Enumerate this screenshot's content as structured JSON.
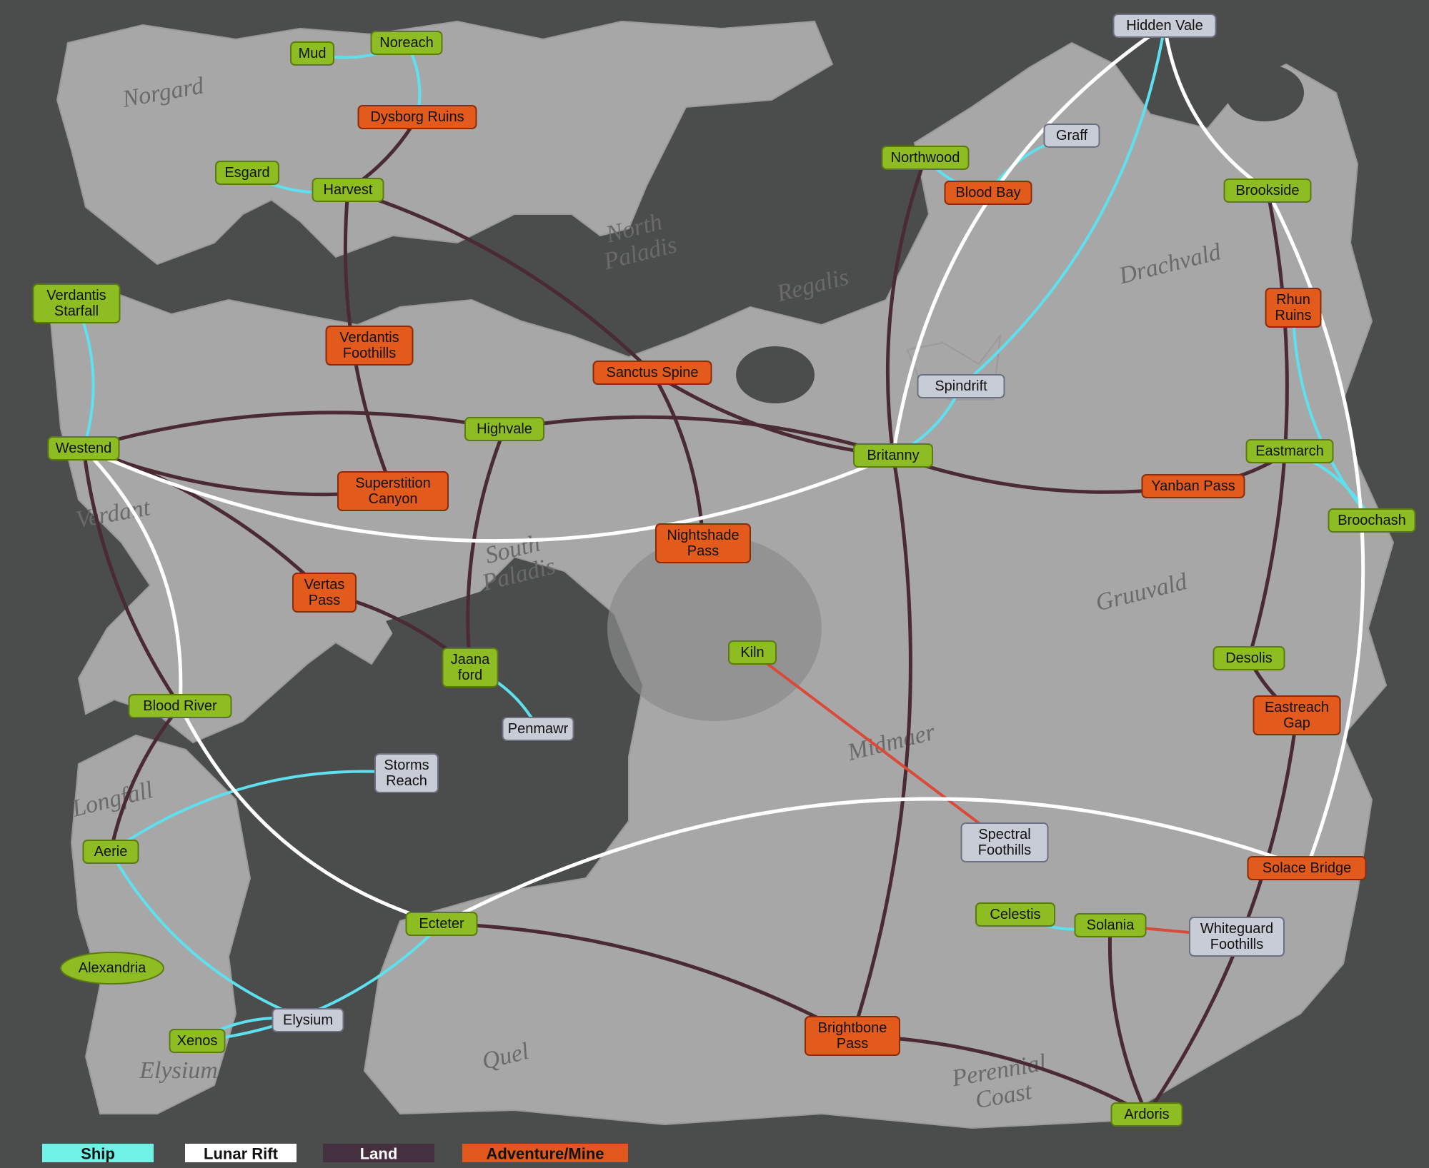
{
  "colors": {
    "background": "#4b4d4d",
    "land_mass": "#a7a7a7",
    "ship_route": "#5fe0ee",
    "lunar_rift": "#ffffff",
    "land_route": "#4a2a33",
    "adventure_route": "#d94a3a",
    "town_fill": "#8dbd22",
    "adventure_fill": "#e25a1c",
    "neutral_fill": "#c8ccd6"
  },
  "legend": [
    {
      "label": "Ship",
      "color": "#6ff3e6",
      "text_color": "#111111"
    },
    {
      "label": "Lunar Rift",
      "color": "#ffffff",
      "text_color": "#111111"
    },
    {
      "label": "Land",
      "color": "#45303f",
      "text_color": "#ffffff"
    },
    {
      "label": "Adventure/Mine",
      "color": "#e2581c",
      "text_color": "#111111"
    }
  ],
  "nodes": {
    "mud": {
      "label": "Mud",
      "type": "town"
    },
    "noreach": {
      "label": "Noreach",
      "type": "town"
    },
    "dysborg": {
      "label": "Dysborg Ruins",
      "type": "adventure"
    },
    "esgard": {
      "label": "Esgard",
      "type": "town"
    },
    "harvest": {
      "label": "Harvest",
      "type": "town"
    },
    "verdantis_starfall": {
      "label": "Verdantis\nStarfall",
      "type": "town"
    },
    "verdantis_foothills": {
      "label": "Verdantis\nFoothills",
      "type": "adventure"
    },
    "sanctus": {
      "label": "Sanctus Spine",
      "type": "adventure"
    },
    "westend": {
      "label": "Westend",
      "type": "town"
    },
    "highvale": {
      "label": "Highvale",
      "type": "town"
    },
    "superstition": {
      "label": "Superstition\nCanyon",
      "type": "adventure"
    },
    "britanny": {
      "label": "Britanny",
      "type": "town"
    },
    "nightshade": {
      "label": "Nightshade\nPass",
      "type": "adventure"
    },
    "vertas": {
      "label": "Vertas\nPass",
      "type": "adventure"
    },
    "jaanaford": {
      "label": "Jaana\nford",
      "type": "town"
    },
    "penmawr": {
      "label": "Penmawr",
      "type": "neutral"
    },
    "bloodriver": {
      "label": "Blood River",
      "type": "town"
    },
    "stormsreach": {
      "label": "Storms\nReach",
      "type": "neutral"
    },
    "kiln": {
      "label": "Kiln",
      "type": "town"
    },
    "aerie": {
      "label": "Aerie",
      "type": "town"
    },
    "alexandria": {
      "label": "Alexandria",
      "type": "town"
    },
    "ecteter": {
      "label": "Ecteter",
      "type": "town"
    },
    "elysium": {
      "label": "Elysium",
      "type": "neutral"
    },
    "xenos": {
      "label": "Xenos",
      "type": "town"
    },
    "brightbone": {
      "label": "Brightbone\nPass",
      "type": "adventure"
    },
    "spectral": {
      "label": "Spectral\nFoothills",
      "type": "neutral"
    },
    "hiddenvale": {
      "label": "Hidden Vale",
      "type": "neutral"
    },
    "graff": {
      "label": "Graff",
      "type": "neutral"
    },
    "northwood": {
      "label": "Northwood",
      "type": "town"
    },
    "bloodbay": {
      "label": "Blood Bay",
      "type": "adventure"
    },
    "brookside": {
      "label": "Brookside",
      "type": "town"
    },
    "rhun": {
      "label": "Rhun\nRuins",
      "type": "adventure"
    },
    "spindrift": {
      "label": "Spindrift",
      "type": "neutral"
    },
    "eastmarch": {
      "label": "Eastmarch",
      "type": "town"
    },
    "yanban": {
      "label": "Yanban Pass",
      "type": "adventure"
    },
    "broochash": {
      "label": "Broochash",
      "type": "town"
    },
    "desolis": {
      "label": "Desolis",
      "type": "town"
    },
    "eastreach": {
      "label": "Eastreach\nGap",
      "type": "adventure"
    },
    "solace": {
      "label": "Solace Bridge",
      "type": "adventure"
    },
    "celestis": {
      "label": "Celestis",
      "type": "town"
    },
    "solania": {
      "label": "Solania",
      "type": "town"
    },
    "whiteguard": {
      "label": "Whiteguard\nFoothills",
      "type": "neutral"
    },
    "ardoris": {
      "label": "Ardoris",
      "type": "town"
    }
  },
  "map_labels": [
    "North\nPaladis",
    "South\nPaladis",
    "Regalis",
    "Verdant",
    "Drachvald",
    "Gruuvald",
    "Midmaer",
    "Longfall",
    "Elysium",
    "Quel",
    "Perennial\nCoast",
    "Norgard"
  ],
  "routes": {
    "ship": [
      [
        "mud",
        "noreach"
      ],
      [
        "noreach",
        "dysborg"
      ],
      [
        "esgard",
        "harvest"
      ],
      [
        "verdantis_starfall",
        "westend"
      ],
      [
        "northwood",
        "bloodbay"
      ],
      [
        "bloodbay",
        "graff"
      ],
      [
        "spindrift",
        "hiddenvale"
      ],
      [
        "spindrift",
        "britanny"
      ],
      [
        "rhun",
        "broochash"
      ],
      [
        "eastmarch",
        "broochash"
      ],
      [
        "celestis",
        "solania"
      ],
      [
        "aerie",
        "stormsreach"
      ],
      [
        "aerie",
        "elysium"
      ],
      [
        "xenos",
        "elysium"
      ],
      [
        "xenos",
        "ecteter"
      ],
      [
        "jaanaford",
        "penmawr"
      ]
    ],
    "lunar_rift": [
      [
        "westend",
        "britanny"
      ],
      [
        "westend",
        "bloodriver"
      ],
      [
        "bloodriver",
        "ecteter"
      ],
      [
        "ecteter",
        "solace"
      ],
      [
        "solace",
        "brookside"
      ],
      [
        "brookside",
        "hiddenvale"
      ],
      [
        "hiddenvale",
        "britanny"
      ]
    ],
    "land": [
      [
        "harvest",
        "dysborg"
      ],
      [
        "harvest",
        "sanctus"
      ],
      [
        "harvest",
        "superstition"
      ],
      [
        "westend",
        "highvale"
      ],
      [
        "westend",
        "superstition"
      ],
      [
        "westend",
        "vertas"
      ],
      [
        "westend",
        "bloodriver"
      ],
      [
        "highvale",
        "britanny"
      ],
      [
        "highvale",
        "jaanaford"
      ],
      [
        "sanctus",
        "nightshade"
      ],
      [
        "sanctus",
        "britanny"
      ],
      [
        "britanny",
        "northwood"
      ],
      [
        "britanny",
        "yanban"
      ],
      [
        "britanny",
        "brightbone"
      ],
      [
        "yanban",
        "eastmarch"
      ],
      [
        "brookside",
        "desolis"
      ],
      [
        "desolis",
        "eastreach"
      ],
      [
        "eastreach",
        "ardoris"
      ],
      [
        "ardoris",
        "brightbone"
      ],
      [
        "ecteter",
        "brightbone"
      ],
      [
        "bloodriver",
        "aerie"
      ],
      [
        "vertas",
        "jaanaford"
      ],
      [
        "solania",
        "ardoris"
      ]
    ],
    "adventure": [
      [
        "kiln",
        "spectral"
      ],
      [
        "solania",
        "whiteguard"
      ]
    ]
  }
}
